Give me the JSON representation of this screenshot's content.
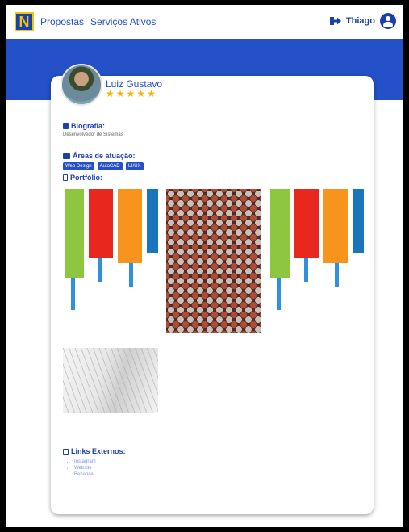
{
  "nav": {
    "logo_letter": "N",
    "links": [
      "Propostas",
      "Serviços Ativos"
    ],
    "user_name": "Thiago"
  },
  "profile": {
    "name": "Luiz Gustavo",
    "rating": 5
  },
  "sections": {
    "bio_title": "Biografia:",
    "bio_text": "Desenvolvedor de Sistemas",
    "areas_title": "Áreas de atuação:",
    "areas": [
      "Web Design",
      "AutoCAD",
      "UI/UX"
    ],
    "portfolio_title": "Portfólio:",
    "links_title": "Links Externos:",
    "links": [
      "Instagram",
      "Website",
      "Behance"
    ]
  },
  "colors": {
    "primary": "#2450c8",
    "star": "#f5b400",
    "logo_accent": "#f5c400"
  }
}
